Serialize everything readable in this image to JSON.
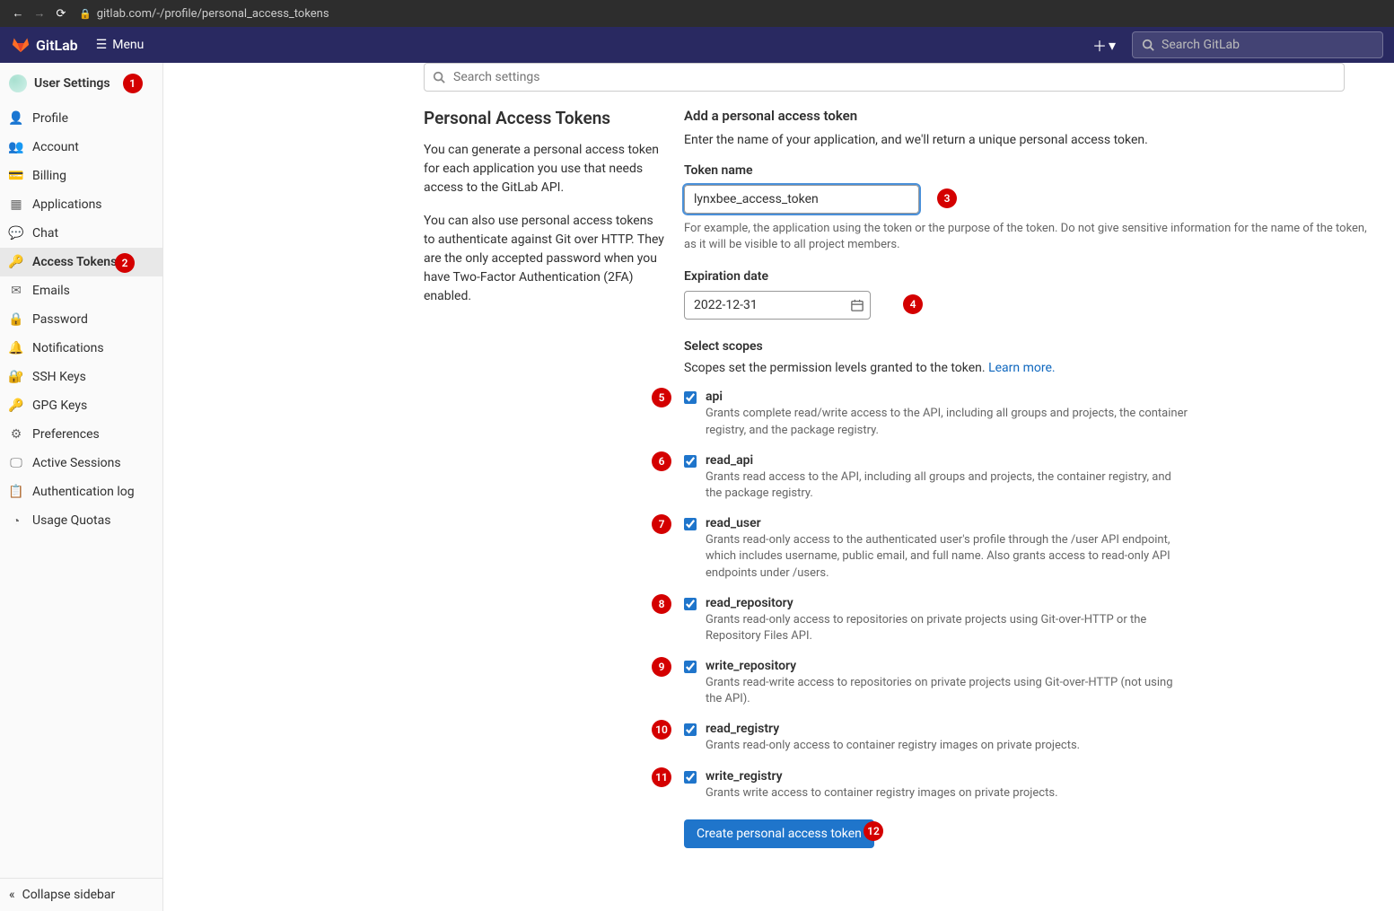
{
  "browser": {
    "url": "gitlab.com/-/profile/personal_access_tokens"
  },
  "topnav": {
    "brand": "GitLab",
    "menu": "Menu",
    "search_placeholder": "Search GitLab"
  },
  "sidebar": {
    "header": "User Settings",
    "items": [
      {
        "label": "Profile",
        "icon": "user"
      },
      {
        "label": "Account",
        "icon": "account"
      },
      {
        "label": "Billing",
        "icon": "card"
      },
      {
        "label": "Applications",
        "icon": "apps"
      },
      {
        "label": "Chat",
        "icon": "chat"
      },
      {
        "label": "Access Tokens",
        "icon": "key",
        "active": true
      },
      {
        "label": "Emails",
        "icon": "mail"
      },
      {
        "label": "Password",
        "icon": "lock"
      },
      {
        "label": "Notifications",
        "icon": "bell"
      },
      {
        "label": "SSH Keys",
        "icon": "sshkey"
      },
      {
        "label": "GPG Keys",
        "icon": "gpgkey"
      },
      {
        "label": "Preferences",
        "icon": "prefs"
      },
      {
        "label": "Active Sessions",
        "icon": "sessions"
      },
      {
        "label": "Authentication log",
        "icon": "log"
      },
      {
        "label": "Usage Quotas",
        "icon": "quota"
      }
    ],
    "collapse": "Collapse sidebar"
  },
  "search_settings_placeholder": "Search settings",
  "left": {
    "title": "Personal Access Tokens",
    "p1": "You can generate a personal access token for each application you use that needs access to the GitLab API.",
    "p2": "You can also use personal access tokens to authenticate against Git over HTTP. They are the only accepted password when you have Two-Factor Authentication (2FA) enabled."
  },
  "form": {
    "heading": "Add a personal access token",
    "sub": "Enter the name of your application, and we'll return a unique personal access token.",
    "token_name_label": "Token name",
    "token_name_value": "lynxbee_access_token",
    "token_name_help": "For example, the application using the token or the purpose of the token. Do not give sensitive information for the name of the token, as it will be visible to all project members.",
    "expiration_label": "Expiration date",
    "expiration_value": "2022-12-31",
    "scopes_label": "Select scopes",
    "scopes_hint": "Scopes set the permission levels granted to the token. ",
    "scopes_link": "Learn more.",
    "scopes": [
      {
        "name": "api",
        "desc": "Grants complete read/write access to the API, including all groups and projects, the container registry, and the package registry.",
        "checked": true
      },
      {
        "name": "read_api",
        "desc": "Grants read access to the API, including all groups and projects, the container registry, and the package registry.",
        "checked": true
      },
      {
        "name": "read_user",
        "desc": "Grants read-only access to the authenticated user's profile through the /user API endpoint, which includes username, public email, and full name. Also grants access to read-only API endpoints under /users.",
        "checked": true
      },
      {
        "name": "read_repository",
        "desc": "Grants read-only access to repositories on private projects using Git-over-HTTP or the Repository Files API.",
        "checked": true
      },
      {
        "name": "write_repository",
        "desc": "Grants read-write access to repositories on private projects using Git-over-HTTP (not using the API).",
        "checked": true
      },
      {
        "name": "read_registry",
        "desc": "Grants read-only access to container registry images on private projects.",
        "checked": true
      },
      {
        "name": "write_registry",
        "desc": "Grants write access to container registry images on private projects.",
        "checked": true
      }
    ],
    "create_button": "Create personal access token"
  },
  "annotations": [
    "1",
    "2",
    "3",
    "4",
    "5",
    "6",
    "7",
    "8",
    "9",
    "10",
    "11",
    "12"
  ]
}
